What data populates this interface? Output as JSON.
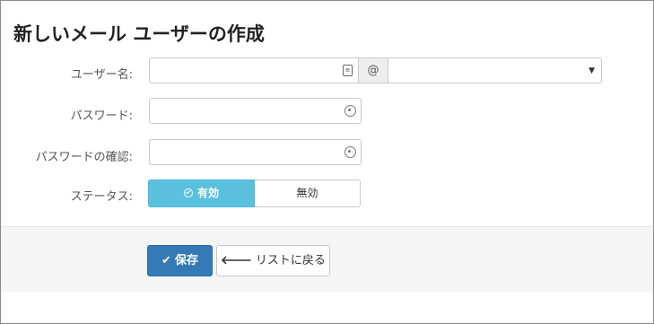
{
  "page": {
    "title": "新しいメール ユーザーの作成"
  },
  "form": {
    "username": {
      "label": "ユーザー名:",
      "value": "",
      "at_symbol": "@",
      "domain_value": "",
      "caret": "▼"
    },
    "password": {
      "label": "パスワード:",
      "value": ""
    },
    "confirm_password": {
      "label": "パスワードの確認:",
      "value": ""
    },
    "status": {
      "label": "ステータス:",
      "options": [
        "有効",
        "無効"
      ],
      "selected": "有効"
    }
  },
  "actions": {
    "save": {
      "icon": "✔",
      "label": "保存",
      "color": "#337ab7"
    },
    "back": {
      "icon": "🡐",
      "label": "リストに戻る"
    }
  },
  "colors": {
    "status_active": "#5bc0de",
    "footer_bg": "#f5f5f5"
  },
  "icons": {
    "username_field": "address-card-icon",
    "password_field": "key-icon",
    "status_active": "check-circle-icon",
    "save": "check-icon",
    "back": "arrow-left-icon"
  }
}
